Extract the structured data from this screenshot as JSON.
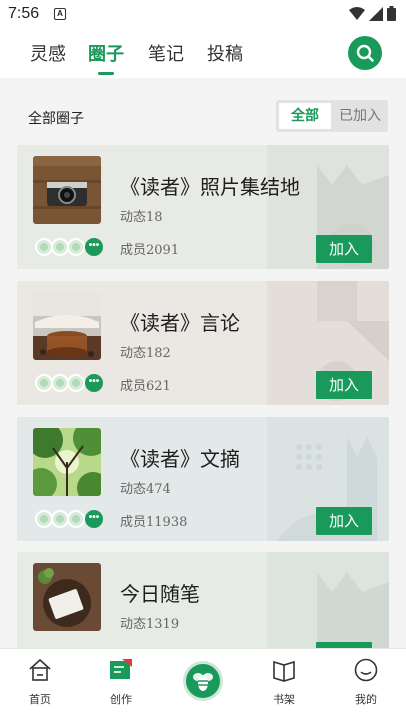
{
  "status": {
    "time": "7:56",
    "notif_glyph": "A",
    "icons": [
      "wifi-icon",
      "signal-icon",
      "battery-icon"
    ]
  },
  "top_tabs": [
    {
      "label": "灵感",
      "active": false
    },
    {
      "label": "圈子",
      "active": true
    },
    {
      "label": "笔记",
      "active": false
    },
    {
      "label": "投稿",
      "active": false
    }
  ],
  "section": {
    "title": "全部圈子",
    "filter_all": "全部",
    "filter_joined": "已加入"
  },
  "circles": [
    {
      "name": "《读者》照片集结地",
      "posts": "动态18",
      "members": "成员2091",
      "join": "加入",
      "thumb": "camera-photo"
    },
    {
      "name": "《读者》言论",
      "posts": "动态182",
      "members": "成员621",
      "join": "加入",
      "thumb": "coffee-book-photo"
    },
    {
      "name": "《读者》文摘",
      "posts": "动态474",
      "members": "成员11938",
      "join": "加入",
      "thumb": "tree-canopy-photo"
    },
    {
      "name": "今日随笔",
      "posts": "动态1319",
      "members": "",
      "join": "加入",
      "thumb": "notebook-photo"
    }
  ],
  "avatar_more": "•••",
  "bottom_nav": [
    {
      "label": "首页",
      "icon": "home-icon"
    },
    {
      "label": "创作",
      "icon": "create-icon"
    },
    {
      "label": "",
      "icon": "bee-logo-icon"
    },
    {
      "label": "书架",
      "icon": "bookshelf-icon"
    },
    {
      "label": "我的",
      "icon": "profile-icon"
    }
  ],
  "colors": {
    "accent": "#1a9a5a",
    "text": "#222222"
  }
}
